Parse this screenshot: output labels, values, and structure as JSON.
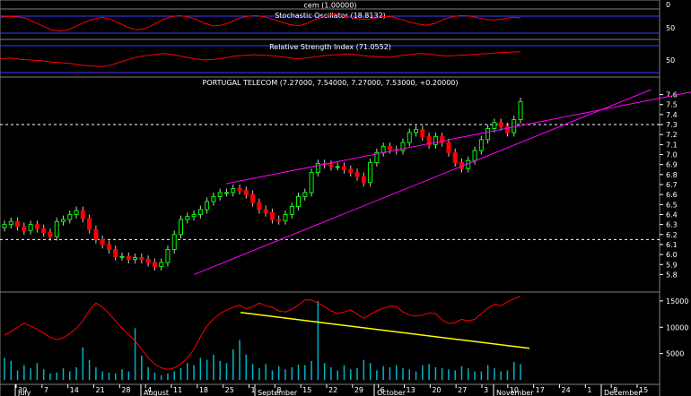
{
  "colors": {
    "background": "#000000",
    "grid": "#7f7f7f",
    "up_candle": "#00ff00",
    "down_candle": "#ff0000",
    "oscillator_line": "#ff0000",
    "band_line": "#3c3cff",
    "wedge_line": "#ff00ff",
    "volume_bar": "#00b4c8",
    "volume_trend": "#ffff00",
    "level_line": "#ffffff"
  },
  "chart_data": [
    {
      "type": "line",
      "panel": "cem",
      "title": "cem (1.00000)",
      "right_axis": [
        "0"
      ]
    },
    {
      "type": "line",
      "panel": "stochastic",
      "title": "Stochastic Oscillator (18.8132)",
      "right_axis": [
        "50"
      ],
      "band_levels": [
        80,
        20
      ],
      "series": [
        {
          "values": [
            78,
            82,
            80,
            75,
            60,
            45,
            30,
            25,
            30,
            45,
            60,
            72,
            78,
            70,
            55,
            40,
            30,
            35,
            50,
            68,
            80,
            85,
            80,
            70,
            55,
            45,
            48,
            60,
            75,
            82,
            85,
            80,
            70,
            60,
            50,
            45,
            55,
            70,
            82,
            88,
            85,
            78,
            72,
            70,
            75,
            82,
            80,
            70,
            60,
            52,
            48,
            55,
            70,
            80,
            85,
            83,
            76,
            70,
            68,
            72,
            78,
            76
          ]
        }
      ]
    },
    {
      "type": "line",
      "panel": "rsi",
      "title": "Relative Strength Index (71.0552)",
      "right_axis": [
        "50"
      ],
      "band_levels": [
        70,
        30
      ],
      "series": [
        {
          "values": [
            50,
            52,
            48,
            46,
            44,
            40,
            38,
            35,
            30,
            28,
            26,
            32,
            42,
            52,
            58,
            62,
            66,
            62,
            56,
            50,
            46,
            48,
            52,
            58,
            60,
            62,
            60,
            58,
            54,
            50,
            52,
            56,
            60,
            62,
            64,
            62,
            58,
            56,
            54,
            58,
            62,
            66,
            64,
            60,
            58,
            60,
            62,
            64,
            66,
            68,
            70,
            71
          ]
        }
      ]
    },
    {
      "type": "candlestick",
      "panel": "price",
      "title": "PORTUGAL TELECOM (7.27000, 7.54000, 7.27000, 7.53000, +0.20000)",
      "right_axis": [
        "7.6",
        "7.5",
        "7.4",
        "7.3",
        "7.2",
        "7.1",
        "7.0",
        "6.9",
        "6.8",
        "6.7",
        "6.6",
        "6.5",
        "6.4",
        "6.3",
        "6.2",
        "6.1",
        "6.0",
        "5.9",
        "5.8"
      ],
      "ylim": [
        5.75,
        7.65
      ],
      "reference_levels": [
        7.3,
        6.15
      ],
      "wedge": {
        "upper": [
          [
            34,
            6.71
          ],
          [
            107,
            7.65
          ]
        ],
        "lower": [
          [
            29,
            5.8
          ],
          [
            99,
            7.65
          ]
        ]
      },
      "close": [
        6.3,
        6.33,
        6.28,
        6.24,
        6.3,
        6.26,
        6.22,
        6.18,
        6.33,
        6.35,
        6.4,
        6.44,
        6.36,
        6.25,
        6.15,
        6.1,
        6.05,
        5.98,
        5.98,
        5.95,
        5.97,
        5.95,
        5.92,
        5.88,
        5.92,
        6.05,
        6.2,
        6.35,
        6.38,
        6.4,
        6.45,
        6.53,
        6.58,
        6.62,
        6.62,
        6.66,
        6.64,
        6.6,
        6.52,
        6.45,
        6.42,
        6.35,
        6.34,
        6.4,
        6.48,
        6.58,
        6.62,
        6.82,
        6.91,
        6.9,
        6.88,
        6.88,
        6.85,
        6.82,
        6.78,
        6.72,
        6.92,
        7.02,
        7.08,
        7.05,
        7.04,
        7.12,
        7.22,
        7.25,
        7.18,
        7.1,
        7.18,
        7.12,
        7.02,
        6.92,
        6.86,
        6.94,
        7.04,
        7.15,
        7.26,
        7.32,
        7.28,
        7.22,
        7.35,
        7.53
      ]
    },
    {
      "type": "bar",
      "panel": "volume",
      "right_axis": [
        "15000",
        "10000",
        "5000"
      ],
      "ylim": [
        0,
        16000
      ],
      "values": [
        4200,
        3600,
        1800,
        2800,
        2200,
        3200,
        2000,
        1200,
        1400,
        2200,
        1600,
        2400,
        6200,
        3800,
        2400,
        1600,
        1400,
        1200,
        2000,
        1600,
        9800,
        4600,
        2400,
        1400,
        900,
        1200,
        1600,
        2200,
        3200,
        2800,
        4200,
        3800,
        4800,
        3600,
        3200,
        5800,
        7600,
        4800,
        3000,
        2200,
        3000,
        1800,
        2600,
        2000,
        2400,
        2900,
        2800,
        3600,
        15000,
        3200,
        2400,
        1800,
        2800,
        2000,
        2200,
        3800,
        3200,
        1800,
        2600,
        2400,
        2800,
        2200,
        2000,
        1600,
        2800,
        3000,
        2400,
        2200,
        2000,
        1800,
        2600,
        2200,
        1600,
        1600,
        2800,
        2200,
        1600,
        1800,
        3400,
        3000
      ],
      "volume_ma": [
        8500,
        9200,
        10000,
        10800,
        10200,
        9600,
        8900,
        8100,
        7600,
        8000,
        8800,
        9800,
        11200,
        13200,
        14600,
        13800,
        12600,
        11200,
        9800,
        8600,
        7400,
        5800,
        4200,
        3000,
        2300,
        2000,
        2300,
        3000,
        4200,
        5800,
        8200,
        10200,
        11600,
        12600,
        13300,
        13800,
        14200,
        13500,
        13900,
        14600,
        14100,
        13800,
        13100,
        12900,
        13400,
        14200,
        15200,
        15200,
        14600,
        13900,
        13100,
        12600,
        12900,
        13300,
        12500,
        11700,
        12400,
        13100,
        13600,
        14000,
        13900,
        12900,
        12300,
        12100,
        12300,
        12700,
        12600,
        11400,
        10700,
        10900,
        11500,
        11200,
        11500,
        12600,
        13600,
        14400,
        14100,
        14800,
        15400,
        15900
      ],
      "trendline": [
        [
          0,
          12800
        ],
        [
          20,
          6000
        ]
      ]
    }
  ],
  "x_axis": {
    "labels": [
      "30",
      "7",
      "14",
      "21",
      "28",
      "4",
      "11",
      "18",
      "25",
      "1",
      "8",
      "15",
      "22",
      "29",
      "6",
      "13",
      "20",
      "27",
      "3",
      "10",
      "17",
      "24",
      "1",
      "8",
      "15"
    ],
    "months": [
      "July",
      "August",
      "September",
      "October",
      "November",
      "December"
    ]
  }
}
